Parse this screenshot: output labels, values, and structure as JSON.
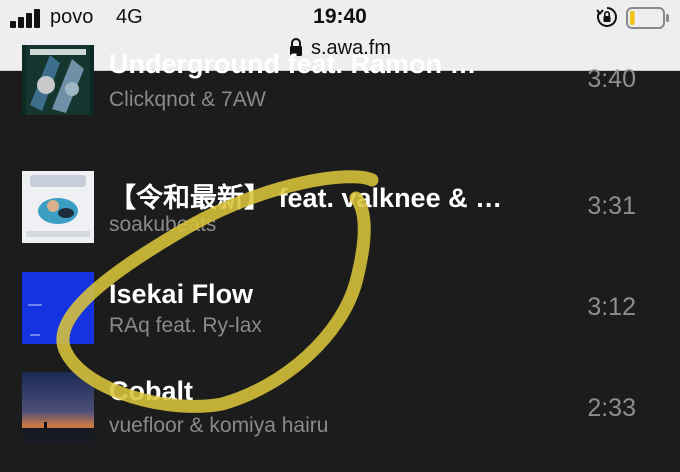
{
  "status_bar": {
    "carrier": "povo",
    "network": "4G",
    "time": "19:40",
    "url": "s.awa.fm",
    "icons": [
      "signal-bars-icon",
      "lock-icon",
      "orientation-lock-icon",
      "battery-icon"
    ],
    "battery_level": 0.15
  },
  "tracks": [
    {
      "title": "Underground feat. Ramon …",
      "artist": "Clickqnot & 7AW",
      "duration": "3:40"
    },
    {
      "title": "【令和最新】 feat. valknee & …",
      "artist": "soakubeats",
      "duration": "3:31"
    },
    {
      "title": "Isekai Flow",
      "artist": "RAq feat. Ry-lax",
      "duration": "3:12"
    },
    {
      "title": "Cobalt",
      "artist": "vuefloor & komiya hairu",
      "duration": "2:33"
    }
  ],
  "colors": {
    "background": "#1c1c1c",
    "status_bar_bg": "#eeeef0",
    "title_text": "#ffffff",
    "secondary_text": "#8a8a8a",
    "annotation_stroke": "#d9c43a"
  }
}
